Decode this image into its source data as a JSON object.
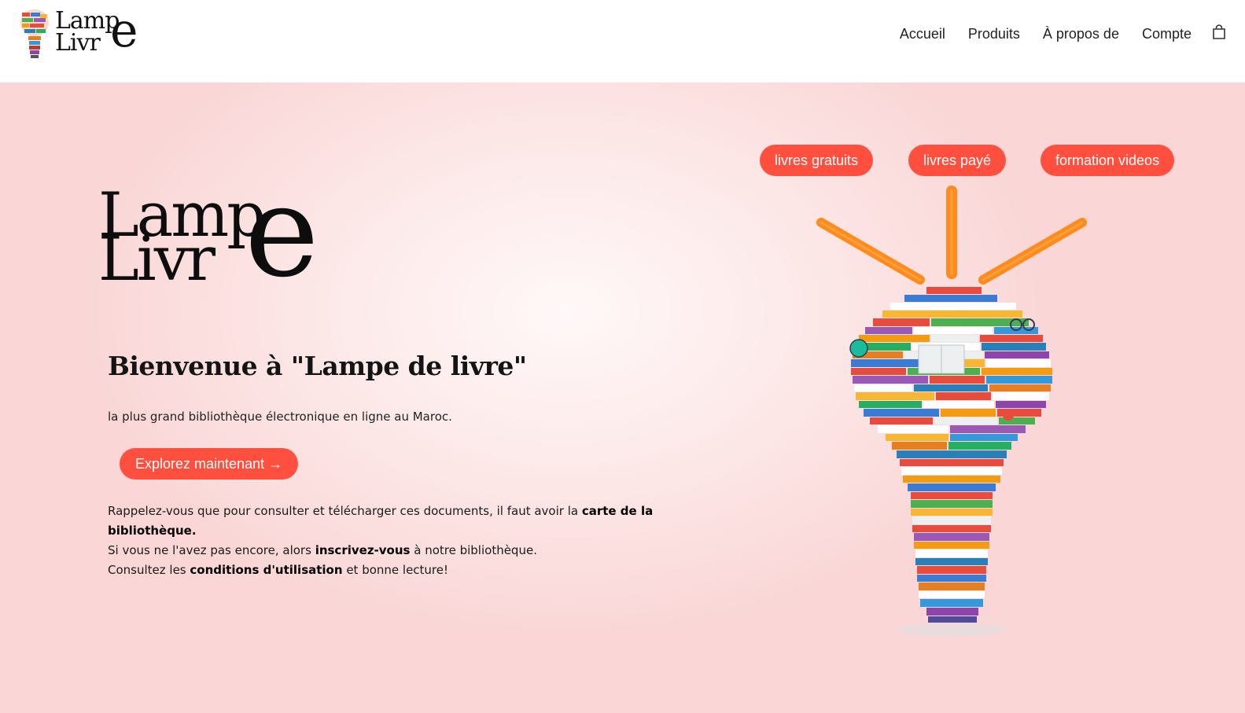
{
  "header": {
    "logo": {
      "line1": "Lamp",
      "line2": "Livr",
      "accent": "e"
    },
    "nav": {
      "home": "Accueil",
      "products": "Produits",
      "about": "À propos de",
      "account": "Compte",
      "cart_icon": "shopping-bag-icon"
    }
  },
  "hero": {
    "big_logo": {
      "line1": "Lamp",
      "line2": "Livr",
      "accent": "e"
    },
    "title": "Bienvenue à \"Lampe de livre\"",
    "tagline": "la plus grand bibliothèque électronique en ligne au Maroc.",
    "cta_label": "Explorez maintenant →",
    "notice": {
      "p1_a": "Rappelez-vous que pour consulter et télécharger ces documents, il faut avoir la ",
      "p1_b": "carte de la bibliothèque",
      "p1_c": ".",
      "p2_a": "Si vous ne l'avez pas encore, alors ",
      "p2_b": "inscrivez-vous",
      "p2_c": " à notre bibliothèque.",
      "p3_a": "Consultez les ",
      "p3_b": "conditions d'utilisation",
      "p3_c": " et bonne lecture!"
    },
    "pills": {
      "free": "livres gratuits",
      "paid": "livres payé",
      "videos": "formation videos"
    },
    "illustration_icon": "book-lightbulb-illustration"
  },
  "colors": {
    "accent": "#ff4f3f",
    "hero_bg": "#fad6d6",
    "ray_orange": "#ff8a1e"
  }
}
